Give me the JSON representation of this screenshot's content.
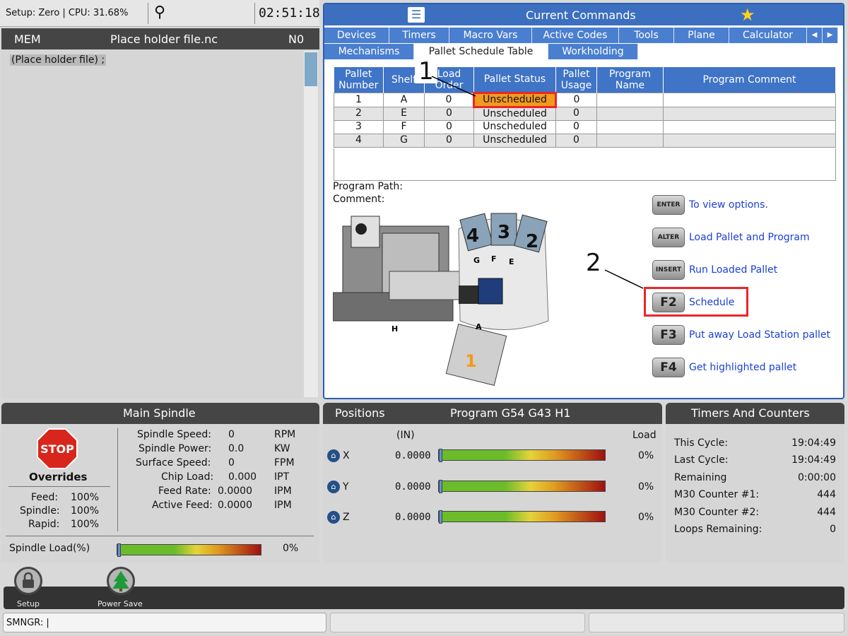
{
  "status_bar": {
    "setup_text": "Setup: Zero | CPU: 31.68%",
    "clock": "02:51:18"
  },
  "program": {
    "mode": "MEM",
    "file": "Place holder file.nc",
    "n_number": "N0",
    "code_line": "(Place holder file) ;"
  },
  "commands": {
    "title": "Current Commands",
    "tabs_row1": [
      "Devices",
      "Timers",
      "Macro Vars",
      "Active Codes",
      "Tools",
      "Plane",
      "Calculator"
    ],
    "tabs_row2": [
      "Mechanisms",
      "Pallet Schedule Table",
      "Workholding"
    ],
    "table": {
      "headers": [
        "Pallet Number",
        "Shelf",
        "Load Order",
        "Pallet Status",
        "Pallet Usage",
        "Program Name",
        "Program Comment"
      ],
      "rows": [
        [
          "1",
          "A",
          "0",
          "Unscheduled",
          "0",
          "",
          ""
        ],
        [
          "2",
          "E",
          "0",
          "Unscheduled",
          "0",
          "",
          ""
        ],
        [
          "3",
          "F",
          "0",
          "Unscheduled",
          "0",
          "",
          ""
        ],
        [
          "4",
          "G",
          "0",
          "Unscheduled",
          "0",
          "",
          ""
        ]
      ]
    },
    "program_path_label": "Program Path:",
    "comment_label": "Comment:",
    "callouts": [
      "1",
      "2"
    ],
    "diagram_labels": {
      "p4": "4",
      "p3": "3",
      "p2": "2",
      "p1": "1",
      "g": "G",
      "f": "F",
      "e": "E",
      "a": "A",
      "h": "H"
    },
    "actions": [
      {
        "key": "ENTER",
        "label": "To view options."
      },
      {
        "key": "ALTER",
        "label": "Load Pallet and Program"
      },
      {
        "key": "INSERT",
        "label": "Run Loaded Pallet"
      },
      {
        "key": "F2",
        "label": "Schedule"
      },
      {
        "key": "F3",
        "label": "Put away Load Station pallet"
      },
      {
        "key": "F4",
        "label": "Get highlighted pallet"
      }
    ]
  },
  "spindle": {
    "title": "Main Spindle",
    "stop": "STOP",
    "overrides_title": "Overrides",
    "overrides": [
      [
        "Feed:",
        "100%"
      ],
      [
        "Spindle:",
        "100%"
      ],
      [
        "Rapid:",
        "100%"
      ]
    ],
    "stats": [
      [
        "Spindle Speed:",
        "0",
        "RPM"
      ],
      [
        "Spindle Power:",
        "0.0",
        "KW"
      ],
      [
        "Surface Speed:",
        "0",
        "FPM"
      ],
      [
        "Chip Load:",
        "0.000",
        "IPT"
      ],
      [
        "Feed Rate:",
        "0.0000",
        "IPM"
      ],
      [
        "Active Feed:",
        "0.0000",
        "IPM"
      ]
    ],
    "load_label": "Spindle Load(%)",
    "load_value": "0%"
  },
  "positions": {
    "title_left": "Positions",
    "title_right": "Program G54 G43 H1",
    "unit": "(IN)",
    "load_label": "Load",
    "axes": [
      {
        "axis": "X",
        "value": "0.0000",
        "load": "0%"
      },
      {
        "axis": "Y",
        "value": "0.0000",
        "load": "0%"
      },
      {
        "axis": "Z",
        "value": "0.0000",
        "load": "0%"
      }
    ]
  },
  "timers": {
    "title": "Timers And Counters",
    "rows": [
      [
        "This Cycle:",
        "19:04:49"
      ],
      [
        "Last Cycle:",
        "19:04:49"
      ],
      [
        "Remaining",
        "0:00:00"
      ],
      [
        "M30 Counter #1:",
        "444"
      ],
      [
        "M30 Counter #2:",
        "444"
      ],
      [
        "Loops Remaining:",
        "0"
      ]
    ]
  },
  "dock": {
    "setup": "Setup",
    "power_save": "Power Save"
  },
  "input": {
    "value": "SMNGR: |"
  }
}
